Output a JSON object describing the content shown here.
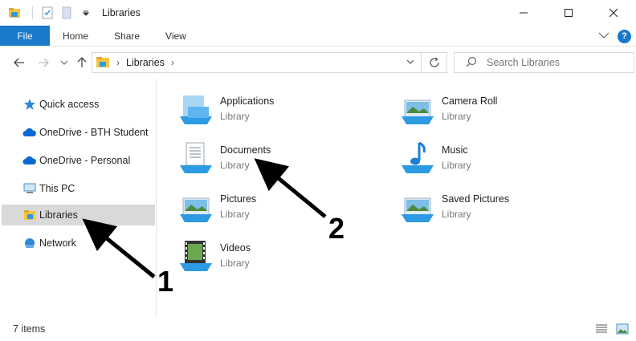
{
  "window": {
    "title": "Libraries"
  },
  "ribbon": {
    "tabs": [
      {
        "label": "File"
      },
      {
        "label": "Home"
      },
      {
        "label": "Share"
      },
      {
        "label": "View"
      }
    ],
    "help_label": "?"
  },
  "address": {
    "crumb": "Libraries",
    "search_placeholder": "Search Libraries"
  },
  "navpane": {
    "items": [
      {
        "label": "Quick access",
        "icon": "star-icon"
      },
      {
        "label": "OneDrive - BTH Student",
        "icon": "cloud-icon"
      },
      {
        "label": "OneDrive - Personal",
        "icon": "cloud-icon"
      },
      {
        "label": "This PC",
        "icon": "computer-icon"
      },
      {
        "label": "Libraries",
        "icon": "libraries-icon",
        "selected": true
      },
      {
        "label": "Network",
        "icon": "network-icon"
      }
    ]
  },
  "libraries": [
    {
      "name": "Applications",
      "type": "Library",
      "icon": "applications-library-icon"
    },
    {
      "name": "Camera Roll",
      "type": "Library",
      "icon": "camera-roll-library-icon"
    },
    {
      "name": "Documents",
      "type": "Library",
      "icon": "documents-library-icon"
    },
    {
      "name": "Music",
      "type": "Library",
      "icon": "music-library-icon"
    },
    {
      "name": "Pictures",
      "type": "Library",
      "icon": "pictures-library-icon"
    },
    {
      "name": "Saved Pictures",
      "type": "Library",
      "icon": "saved-pictures-library-icon"
    },
    {
      "name": "Videos",
      "type": "Library",
      "icon": "videos-library-icon"
    }
  ],
  "status": {
    "item_count": "7 items"
  },
  "annotations": [
    {
      "label": "1",
      "points_to": "Libraries"
    },
    {
      "label": "2",
      "points_to": "Documents"
    }
  ],
  "colors": {
    "accent": "#1979ca",
    "selected_bg": "#d9d9d9",
    "folder_yellow": "#f4c542",
    "library_blue": "#2d9be3"
  }
}
